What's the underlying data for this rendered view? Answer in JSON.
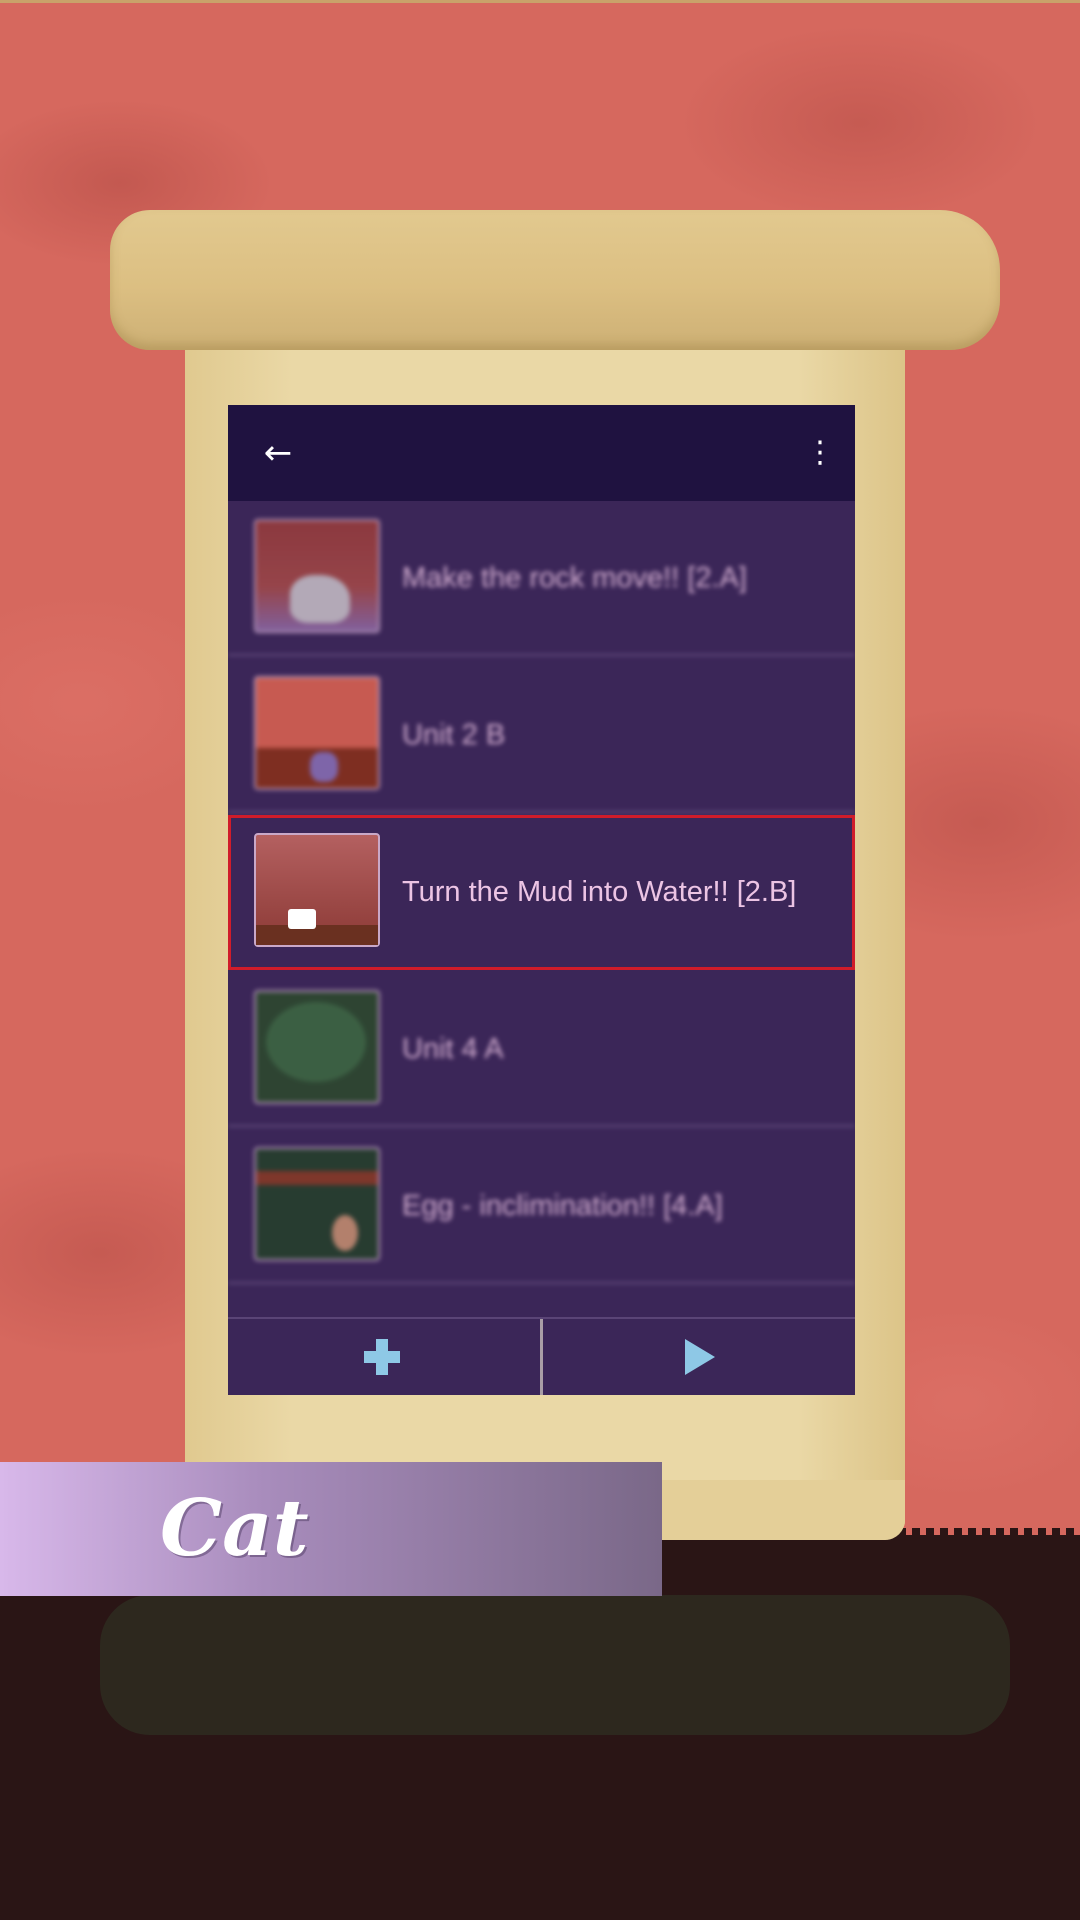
{
  "app": {
    "back_icon": "arrow-left-icon",
    "menu_icon": "more-vertical-icon"
  },
  "list": {
    "items": [
      {
        "title": "Make the rock move!! [2.A]"
      },
      {
        "title": "Unit 2 B"
      },
      {
        "title": "Turn the Mud into Water!! [2.B]",
        "selected": true
      },
      {
        "title": "Unit 4 A"
      },
      {
        "title": "Egg - inclimination!! [4.A]"
      }
    ]
  },
  "bottom_bar": {
    "add_icon": "plus-icon",
    "play_icon": "play-icon"
  },
  "character": {
    "name": "Cat"
  },
  "colors": {
    "selected_outline": "#d01c2a",
    "row_background": "#3b2658",
    "topbar_background": "#1f1240",
    "accent_icon": "#8ec8e6"
  }
}
